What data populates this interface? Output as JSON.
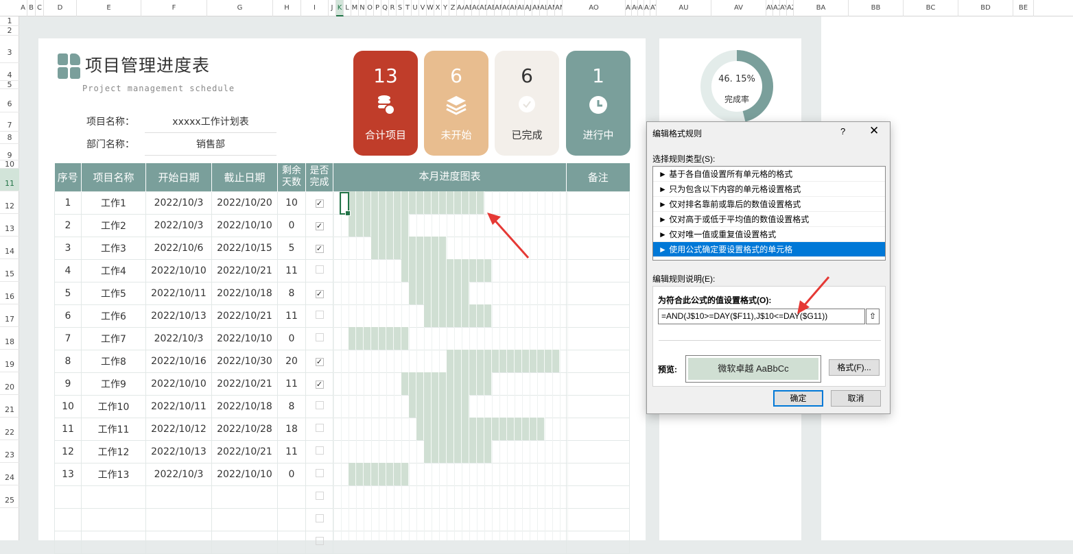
{
  "excel": {
    "columns": [
      "A",
      "B",
      "C",
      "D",
      "E",
      "F",
      "G",
      "H",
      "I",
      "J",
      "K",
      "L",
      "M",
      "N",
      "O",
      "P",
      "Q",
      "R",
      "S",
      "T",
      "U",
      "V",
      "W",
      "X",
      "Y",
      "Z",
      "AA",
      "AB",
      "AC",
      "AD",
      "AE",
      "AF",
      "AG",
      "AH",
      "AI",
      "AJ",
      "AK",
      "AL",
      "AM",
      "AN",
      "AO",
      "AP",
      "AQ",
      "AR",
      "AS",
      "AT",
      "AU",
      "AV",
      "AW",
      "AX",
      "AY",
      "AZ",
      "BA",
      "BB",
      "BC",
      "BD",
      "BE"
    ],
    "rows": [
      "1",
      "2",
      "3",
      "4",
      "5",
      "6",
      "7",
      "8",
      "9",
      "10",
      "11",
      "12",
      "13",
      "14",
      "15",
      "16",
      "17",
      "18",
      "19",
      "20",
      "21",
      "22",
      "23",
      "24",
      "25"
    ],
    "selected_column": "K",
    "selected_row": "11"
  },
  "header": {
    "title": "项目管理进度表",
    "subtitle": "Project management schedule",
    "project_label": "项目名称：",
    "project_value": "xxxxx工作计划表",
    "dept_label": "部门名称：",
    "dept_value": "销售部"
  },
  "cards": [
    {
      "value": "13",
      "label": "合计项目",
      "icon": "coins-icon",
      "bg": "#c03d2a",
      "fg": "#ffffff"
    },
    {
      "value": "6",
      "label": "未开始",
      "icon": "layers-icon",
      "bg": "#e8bd8f",
      "fg": "#ffffff"
    },
    {
      "value": "6",
      "label": "已完成",
      "icon": "check-circle-icon",
      "bg": "#f3efea",
      "fg": "#333333"
    },
    {
      "value": "1",
      "label": "进行中",
      "icon": "clock-icon",
      "bg": "#7a9f9b",
      "fg": "#ffffff"
    }
  ],
  "donut": {
    "percent_text": "46. 15%",
    "label": "完成率",
    "value": 0.4615,
    "color": "#7a9f9b",
    "track": "#e3ecea"
  },
  "table": {
    "headers": {
      "no": "序号",
      "name": "项目名称",
      "start": "开始日期",
      "end": "截止日期",
      "remain1": "剩余",
      "remain2": "天数",
      "done1": "是否",
      "done2": "完成",
      "chart": "本月进度图表",
      "note": "备注"
    },
    "rows": [
      {
        "no": "1",
        "name": "工作1",
        "start": "2022/10/3",
        "end": "2022/10/20",
        "remain": "10",
        "done": true,
        "s": 3,
        "e": 20
      },
      {
        "no": "2",
        "name": "工作2",
        "start": "2022/10/3",
        "end": "2022/10/10",
        "remain": "0",
        "done": true,
        "s": 3,
        "e": 10
      },
      {
        "no": "3",
        "name": "工作3",
        "start": "2022/10/6",
        "end": "2022/10/15",
        "remain": "5",
        "done": true,
        "s": 6,
        "e": 15
      },
      {
        "no": "4",
        "name": "工作4",
        "start": "2022/10/10",
        "end": "2022/10/21",
        "remain": "11",
        "done": false,
        "s": 10,
        "e": 21
      },
      {
        "no": "5",
        "name": "工作5",
        "start": "2022/10/11",
        "end": "2022/10/18",
        "remain": "8",
        "done": true,
        "s": 11,
        "e": 18
      },
      {
        "no": "6",
        "name": "工作6",
        "start": "2022/10/13",
        "end": "2022/10/21",
        "remain": "11",
        "done": false,
        "s": 13,
        "e": 21
      },
      {
        "no": "7",
        "name": "工作7",
        "start": "2022/10/3",
        "end": "2022/10/10",
        "remain": "0",
        "done": false,
        "s": 3,
        "e": 10
      },
      {
        "no": "8",
        "name": "工作8",
        "start": "2022/10/16",
        "end": "2022/10/30",
        "remain": "20",
        "done": true,
        "s": 16,
        "e": 30
      },
      {
        "no": "9",
        "name": "工作9",
        "start": "2022/10/10",
        "end": "2022/10/21",
        "remain": "11",
        "done": true,
        "s": 10,
        "e": 21
      },
      {
        "no": "10",
        "name": "工作10",
        "start": "2022/10/11",
        "end": "2022/10/18",
        "remain": "8",
        "done": false,
        "s": 11,
        "e": 18
      },
      {
        "no": "11",
        "name": "工作11",
        "start": "2022/10/12",
        "end": "2022/10/28",
        "remain": "18",
        "done": false,
        "s": 12,
        "e": 28
      },
      {
        "no": "12",
        "name": "工作12",
        "start": "2022/10/13",
        "end": "2022/10/21",
        "remain": "11",
        "done": false,
        "s": 13,
        "e": 21
      },
      {
        "no": "13",
        "name": "工作13",
        "start": "2022/10/3",
        "end": "2022/10/10",
        "remain": "0",
        "done": false,
        "s": 3,
        "e": 10
      }
    ],
    "empty_rows": 3
  },
  "dialog": {
    "title": "编辑格式规则",
    "help": "?",
    "close": "✕",
    "rule_type_label": "选择规则类型(S):",
    "rule_types": [
      "► 基于各自值设置所有单元格的格式",
      "► 只为包含以下内容的单元格设置格式",
      "► 仅对排名靠前或靠后的数值设置格式",
      "► 仅对高于或低于平均值的数值设置格式",
      "► 仅对唯一值或重复值设置格式",
      "► 使用公式确定要设置格式的单元格"
    ],
    "selected_rule": 5,
    "edit_label": "编辑规则说明(E):",
    "formula_label": "为符合此公式的值设置格式(O):",
    "formula": "=AND(J$10>=DAY($F11),J$10<=DAY($G11))",
    "preview_label": "预览:",
    "preview_text": "微软卓越  AaBbCc",
    "format_button": "格式(F)...",
    "ok": "确定",
    "cancel": "取消"
  }
}
